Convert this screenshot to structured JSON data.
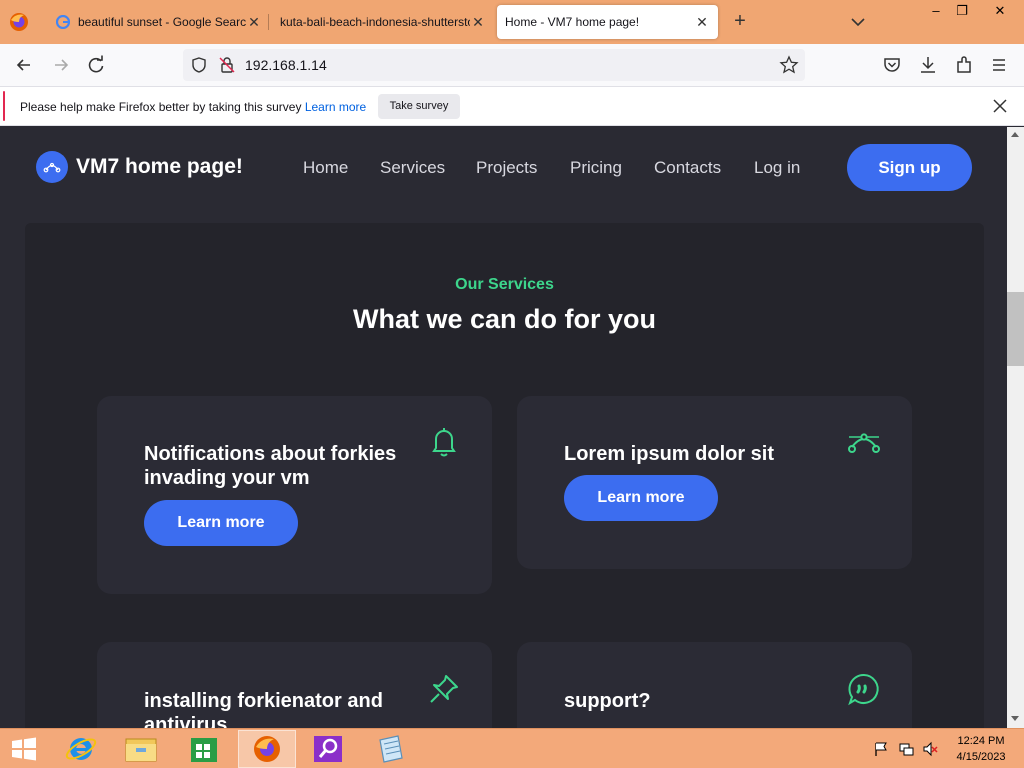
{
  "browser": {
    "tabs": [
      {
        "title": "beautiful sunset - Google Search"
      },
      {
        "title": "kuta-bali-beach-indonesia-shutterstock"
      },
      {
        "title": "Home - VM7 home page!"
      }
    ],
    "url": "192.168.1.14",
    "notification": {
      "message": "Please help make Firefox better by taking this survey",
      "link": "Learn more",
      "button": "Take survey"
    }
  },
  "site": {
    "brand": "VM7 home page!",
    "menu": [
      "Home",
      "Services",
      "Projects",
      "Pricing",
      "Contacts",
      "Log in"
    ],
    "signup": "Sign up"
  },
  "services": {
    "eyebrow": "Our Services",
    "heading": "What we can do for you",
    "cards": [
      {
        "title": "Notifications about forkies invading your vm",
        "button": "Learn more",
        "icon": "bell-icon"
      },
      {
        "title": "Lorem ipsum dolor sit",
        "button": "Learn more",
        "icon": "bezier-icon"
      },
      {
        "title": "installing forkienator and antivirus",
        "icon": "pin-icon"
      },
      {
        "title": "support?",
        "icon": "chat-icon"
      }
    ]
  },
  "taskbar": {
    "time": "12:24 PM",
    "date": "4/15/2023"
  },
  "colors": {
    "accent": "#3c6df0",
    "green": "#3dd68c",
    "page_bg": "#2a2a33"
  }
}
